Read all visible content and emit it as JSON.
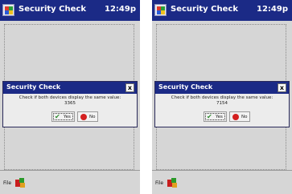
{
  "screens": [
    {
      "title": "Security Check",
      "clock": "12:49p",
      "dialog": {
        "title": "Security Check",
        "close_label": "x",
        "message": "Check if both devices display the same value:",
        "value": "3365",
        "yes_label": "Yes",
        "no_label": "No"
      },
      "menu": {
        "file_label": "File"
      }
    },
    {
      "title": "Security Check",
      "clock": "12:49p",
      "dialog": {
        "title": "Security Check",
        "close_label": "x",
        "message": "Check if both devices display the same value:",
        "value": "7154",
        "yes_label": "Yes",
        "no_label": "No"
      },
      "menu": {
        "file_label": "File"
      }
    }
  ],
  "colors": {
    "titlebar": "#1b2a86",
    "background": "#d6d6d6",
    "yes_check": "#2e8b2e",
    "no_icon": "#d42020"
  },
  "icons": [
    "windows-flag-icon",
    "close-icon",
    "check-icon",
    "no-entry-icon",
    "program-icon"
  ]
}
